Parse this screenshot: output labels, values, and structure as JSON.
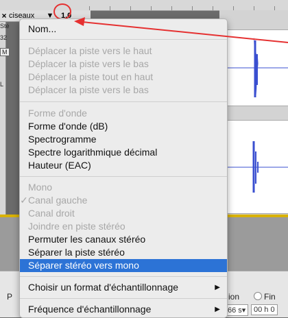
{
  "track": {
    "close": "×",
    "name": "ciseaux",
    "arrow": "▼",
    "value": "1,0",
    "side_labels": [
      "Sté",
      "32",
      "M",
      "L"
    ]
  },
  "menu": {
    "items": [
      {
        "label": "Nom...",
        "enabled": true
      },
      {
        "label": "Déplacer la piste vers le haut",
        "enabled": false
      },
      {
        "label": "Déplacer la piste vers le bas",
        "enabled": false
      },
      {
        "label": "Déplacer la piste tout en haut",
        "enabled": false
      },
      {
        "label": "Déplacer la piste vers le bas",
        "enabled": false
      },
      {
        "label": "Forme d'onde",
        "enabled": false
      },
      {
        "label": "Forme d'onde (dB)",
        "enabled": true
      },
      {
        "label": "Spectrogramme",
        "enabled": true
      },
      {
        "label": "Spectre logarithmique décimal",
        "enabled": true
      },
      {
        "label": "Hauteur (EAC)",
        "enabled": true
      },
      {
        "label": "Mono",
        "enabled": false
      },
      {
        "label": "Canal gauche",
        "enabled": false,
        "checked": true
      },
      {
        "label": "Canal droit",
        "enabled": false
      },
      {
        "label": "Joindre en piste stéréo",
        "enabled": false
      },
      {
        "label": "Permuter les canaux stéréo",
        "enabled": true
      },
      {
        "label": "Séparer la piste stéréo",
        "enabled": true
      },
      {
        "label": "Séparer stéréo vers mono",
        "enabled": true,
        "selected": true
      },
      {
        "label": "Choisir un format d'échantillonnage",
        "enabled": true,
        "submenu": true
      },
      {
        "label": "Fréquence d'échantillonnage",
        "enabled": true,
        "submenu": true
      }
    ],
    "check_glyph": "✓",
    "submenu_glyph": "▶"
  },
  "bottom": {
    "p_label": "P",
    "ion_label": "ion",
    "fin_label": "Fin",
    "time1": "66 s▾",
    "time2": "00 h 0"
  },
  "colors": {
    "selection": "#2c73d6",
    "waveform": "#3a4fd0",
    "annotation": "#e53030",
    "track_frame": "#d9b200"
  }
}
